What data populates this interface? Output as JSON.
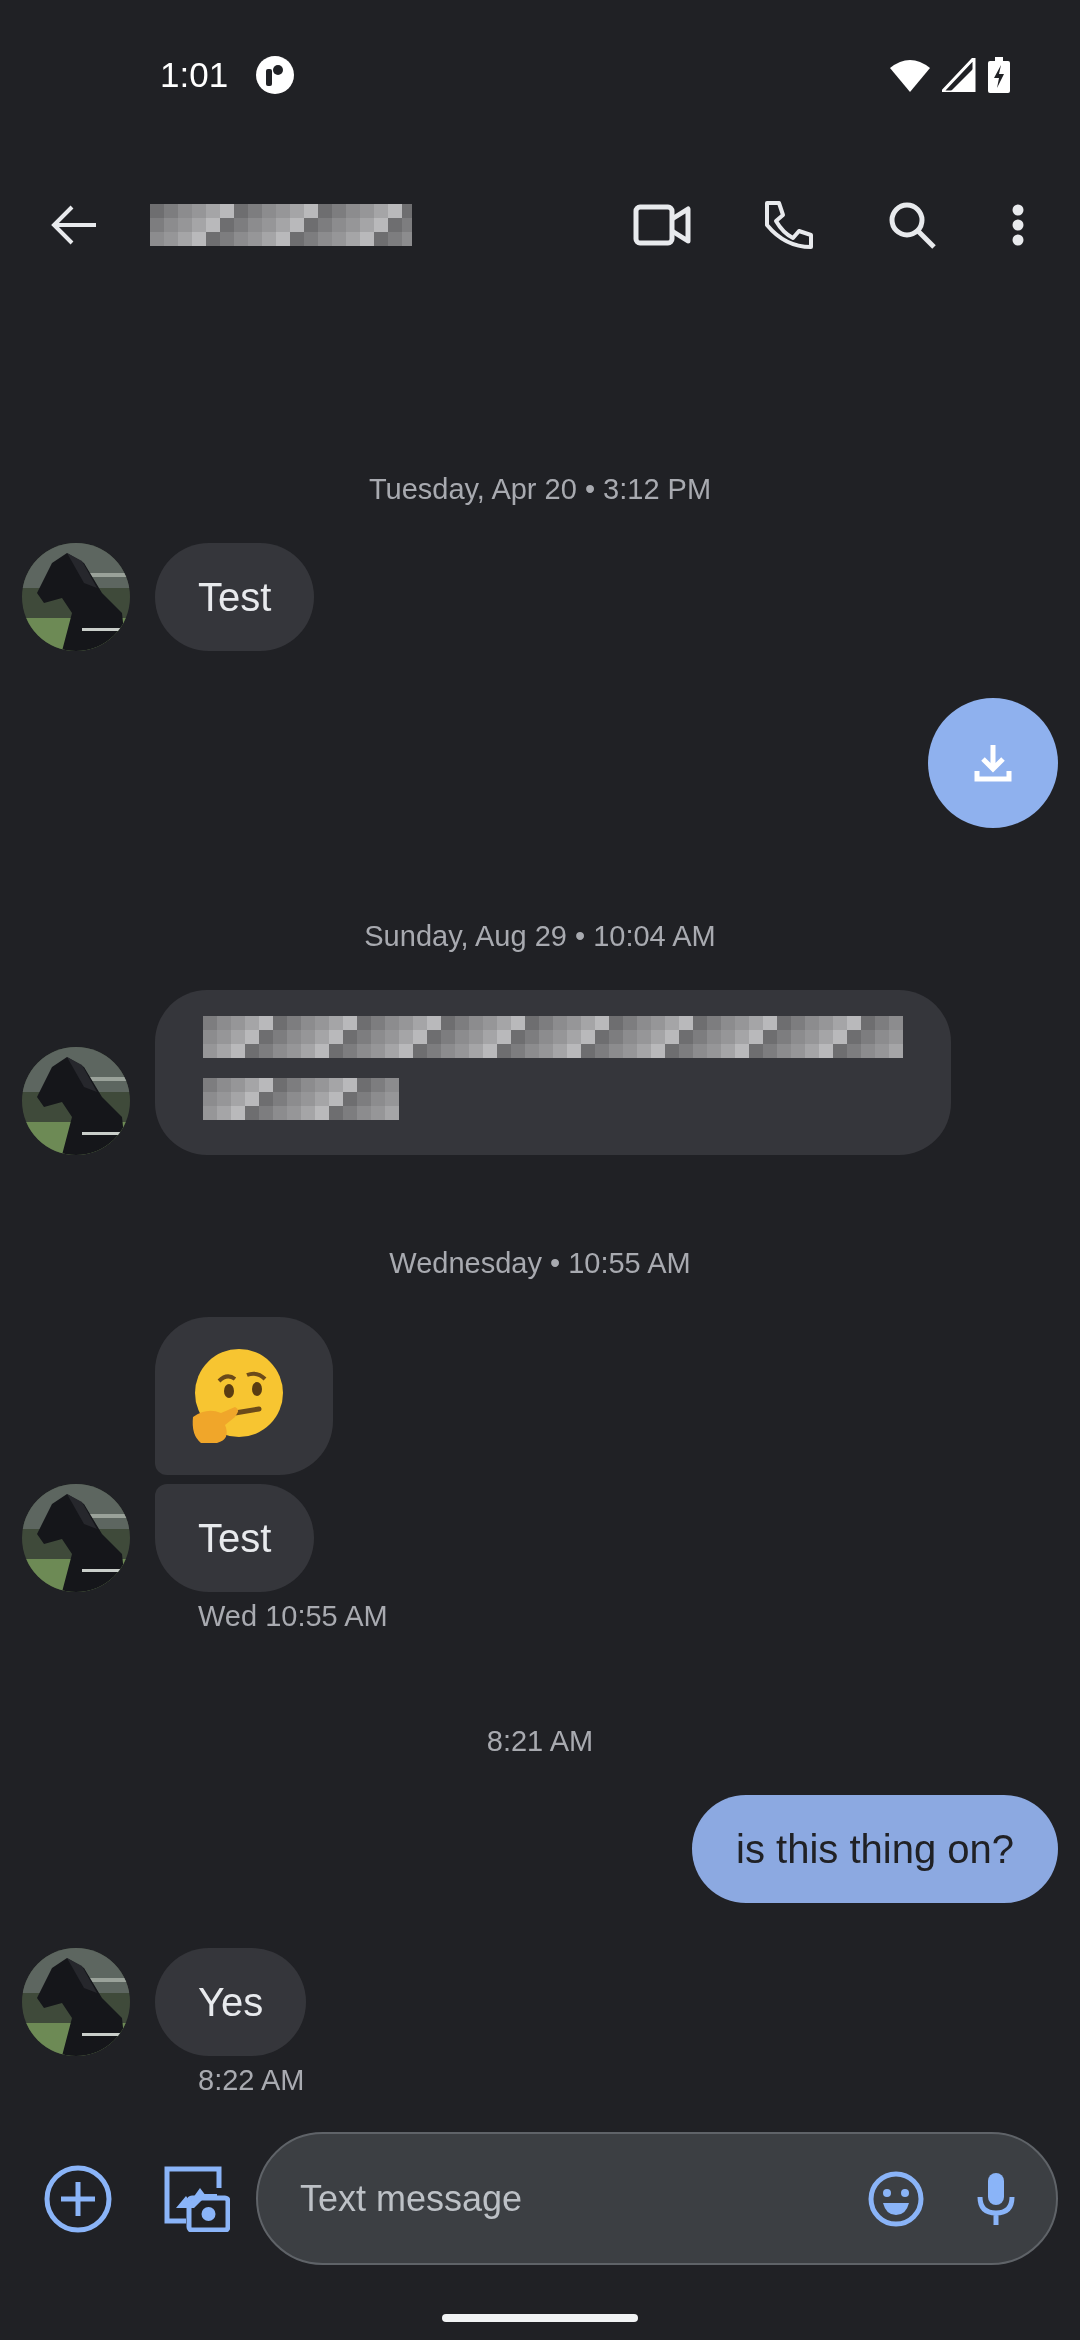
{
  "status_bar": {
    "time": "1:01"
  },
  "thread": [
    {
      "kind": "separator",
      "text": "Tuesday, Apr 20 • 3:12 PM"
    },
    {
      "kind": "incoming",
      "bubbles": [
        {
          "kind": "text",
          "text": "Test"
        }
      ]
    },
    {
      "kind": "download"
    },
    {
      "kind": "separator",
      "text": "Sunday, Aug 29 • 10:04 AM"
    },
    {
      "kind": "incoming",
      "bubbles": [
        {
          "kind": "redacted"
        }
      ]
    },
    {
      "kind": "separator",
      "text": "Wednesday • 10:55 AM"
    },
    {
      "kind": "incoming",
      "bubbles": [
        {
          "kind": "emoji"
        },
        {
          "kind": "text",
          "text": "Test"
        }
      ],
      "time": "Wed 10:55 AM"
    },
    {
      "kind": "separator",
      "text": "8:21 AM"
    },
    {
      "kind": "outgoing",
      "bubbles": [
        {
          "kind": "text",
          "text": "is this thing on?"
        }
      ]
    },
    {
      "kind": "incoming",
      "bubbles": [
        {
          "kind": "text",
          "text": "Yes"
        }
      ],
      "time": "8:22 AM"
    }
  ],
  "composer": {
    "placeholder": "Text message"
  }
}
